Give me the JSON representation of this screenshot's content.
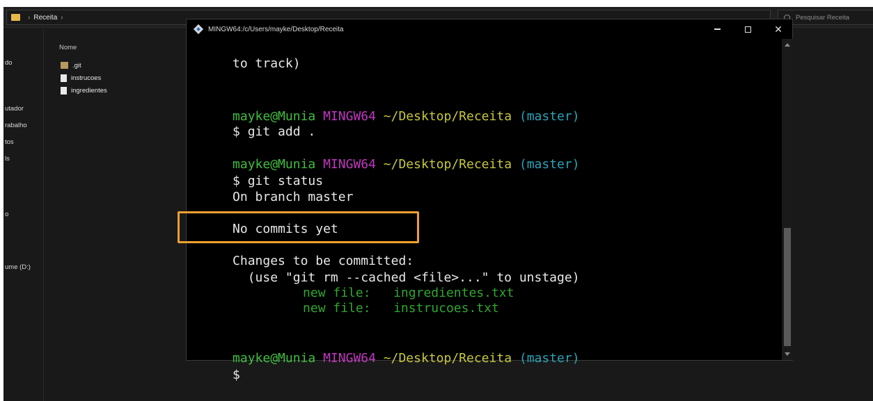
{
  "explorer": {
    "breadcrumb": [
      "Receita"
    ],
    "search_placeholder": "Pesquisar Receita",
    "nav_items": [
      "do",
      "utador",
      "rabalho",
      "tos",
      "ls",
      "o",
      "ume (D:)"
    ],
    "column_header": "Nome",
    "files": [
      {
        "name": ".git",
        "icon": "folder-icon"
      },
      {
        "name": "instrucoes",
        "icon": "file-icon"
      },
      {
        "name": "ingredientes",
        "icon": "file-icon"
      }
    ]
  },
  "terminal": {
    "title": "MINGW64:/c/Users/mayke/Desktop/Receita",
    "colors": {
      "user": "#3fbf3f",
      "env": "#c237c2",
      "path": "#c8c83a",
      "branch": "#29a3b8",
      "staged": "#2fa82f",
      "highlight": "#f0a030"
    },
    "prompt": {
      "user": "mayke@Munia",
      "env": "MINGW64",
      "path": "~/Desktop/Receita",
      "branch": "(master)"
    },
    "lines": {
      "l0": "to track)",
      "cmd1": "$ git add .",
      "cmd2": "$ git status",
      "on_branch": "On branch master",
      "no_commits": "No commits yet",
      "changes": "Changes to be committed:",
      "unstage_hint": "  (use \"git rm --cached <file>...\" to unstage)",
      "new_file_label": "new file:",
      "staged_files": [
        "ingredientes.txt",
        "instrucoes.txt"
      ],
      "final_prompt": "$"
    }
  }
}
